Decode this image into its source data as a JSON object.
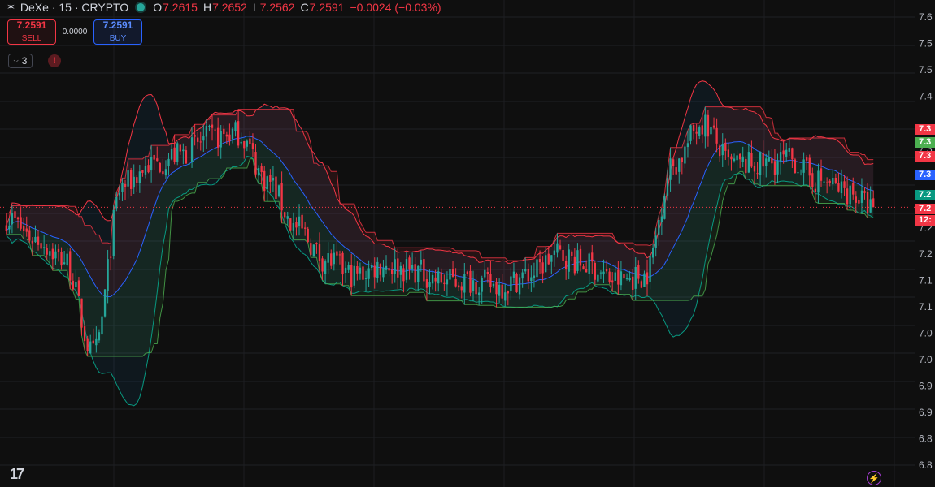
{
  "header": {
    "symbol_text": "DeXe · 15 · CRYPTO",
    "o_label": "O",
    "o_value": "7.2615",
    "h_label": "H",
    "h_value": "7.2652",
    "l_label": "L",
    "l_value": "7.2562",
    "c_label": "C",
    "c_value": "7.2591",
    "change": "−0.0024 (−0.03%)"
  },
  "trade": {
    "sell_price": "7.2591",
    "sell_label": "SELL",
    "spread": "0.0000",
    "buy_price": "7.2591",
    "buy_label": "BUY"
  },
  "indicators": {
    "count": "3",
    "warning": "!"
  },
  "colors": {
    "up": "#26a69a",
    "down": "#f23645",
    "basis": "#2962ff",
    "accent": "#f23645"
  },
  "price_labels": [
    {
      "text": "7.3",
      "color": "#f23645"
    },
    {
      "text": "7.3",
      "color": "#4caf50"
    },
    {
      "text": "7.3",
      "color": "#f23645"
    },
    {
      "text": "7.3",
      "color": "#2962ff"
    },
    {
      "text": "7.2",
      "color": "#089981"
    },
    {
      "text": "7.2",
      "color": "#f23645"
    },
    {
      "text": "12:",
      "color": "#f23645"
    }
  ],
  "chart_data": {
    "type": "line",
    "title": "",
    "xlabel": "",
    "ylabel": "",
    "ylim": [
      6.83,
      7.63
    ],
    "y_ticks": [
      "7.6",
      "7.5",
      "7.5",
      "7.4",
      "7.3",
      "7.3",
      "7.2",
      "7.2",
      "7.1",
      "7.1",
      "7.0",
      "7.0",
      "6.9",
      "6.9",
      "6.8",
      "6.8"
    ],
    "y_tick_values": [
      7.62,
      7.57,
      7.52,
      7.47,
      7.37,
      7.32,
      7.22,
      7.17,
      7.12,
      7.07,
      7.02,
      6.97,
      6.92,
      6.87,
      6.82,
      6.77
    ],
    "current_price": 7.2591,
    "candle_count": 300,
    "series": [
      {
        "x": [
          0,
          10,
          20,
          30,
          40,
          50,
          60,
          70,
          80,
          90,
          100,
          110,
          120,
          130,
          140,
          150,
          160,
          170,
          180,
          190,
          200,
          210,
          220,
          230,
          240,
          250,
          260,
          270,
          280,
          290,
          299
        ],
        "values": [
          7.24,
          7.2,
          7.16,
          6.98,
          7.3,
          7.34,
          7.36,
          7.39,
          7.4,
          7.31,
          7.22,
          7.16,
          7.13,
          7.15,
          7.14,
          7.12,
          7.12,
          7.11,
          7.13,
          7.17,
          7.15,
          7.12,
          7.13,
          7.34,
          7.42,
          7.34,
          7.34,
          7.35,
          7.31,
          7.29,
          7.259
        ]
      }
    ]
  }
}
